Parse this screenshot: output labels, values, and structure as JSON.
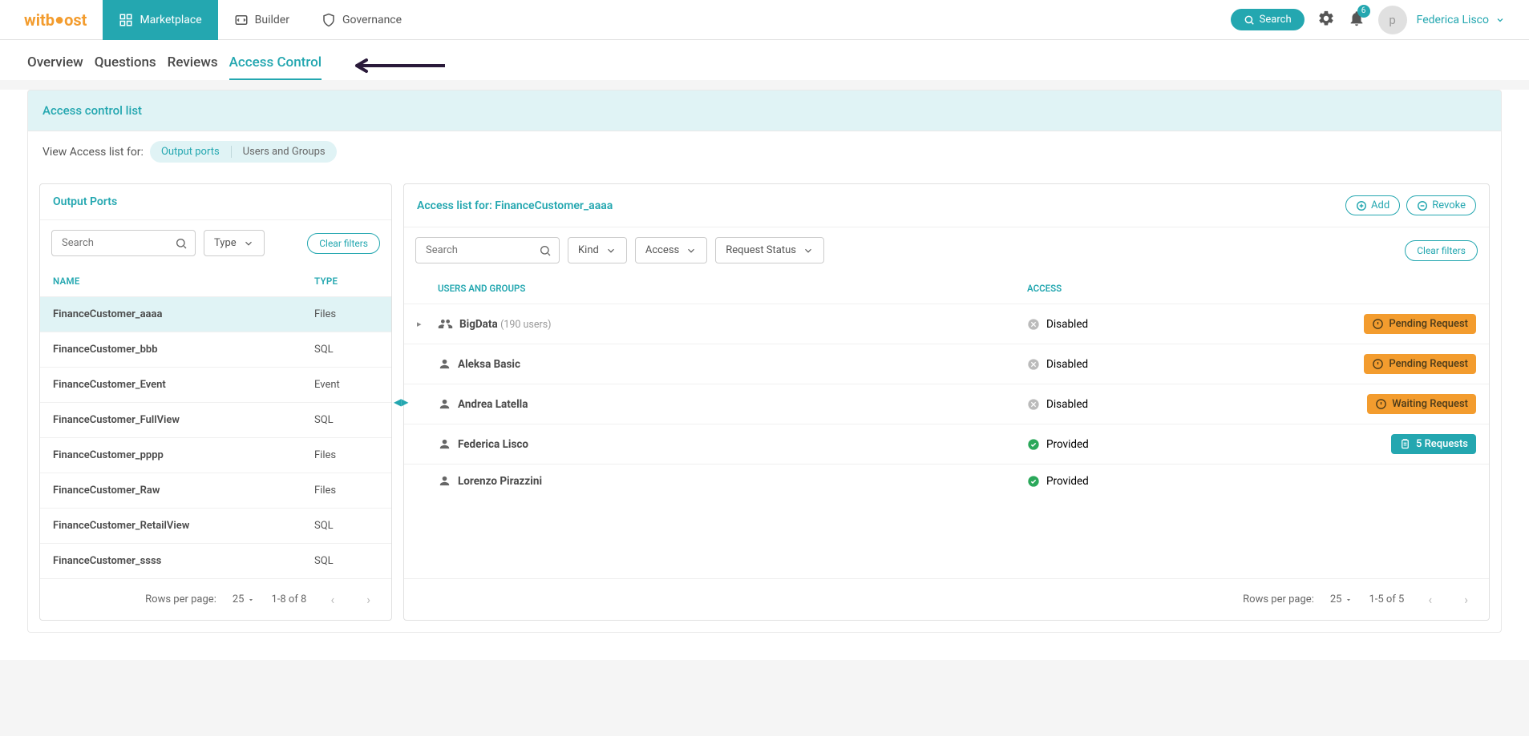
{
  "brand": {
    "part1": "witb",
    "part2": "o",
    "part3": "ost"
  },
  "nav": {
    "marketplace": "Marketplace",
    "builder": "Builder",
    "governance": "Governance"
  },
  "header": {
    "search": "Search",
    "notif_count": "6",
    "avatar_initial": "p",
    "user": "Federica Lisco"
  },
  "tabs": {
    "overview": "Overview",
    "questions": "Questions",
    "reviews": "Reviews",
    "access_control": "Access Control"
  },
  "acl": {
    "title": "Access control list",
    "view_for": "View Access list for:",
    "pill_output": "Output ports",
    "pill_users": "Users and Groups"
  },
  "left_panel": {
    "title": "Output Ports",
    "search_placeholder": "Search",
    "type_label": "Type",
    "clear": "Clear filters",
    "cols": {
      "name": "NAME",
      "type": "TYPE"
    },
    "rows": [
      {
        "name": "FinanceCustomer_aaaa",
        "type": "Files",
        "selected": true
      },
      {
        "name": "FinanceCustomer_bbb",
        "type": "SQL"
      },
      {
        "name": "FinanceCustomer_Event",
        "type": "Event"
      },
      {
        "name": "FinanceCustomer_FullView",
        "type": "SQL"
      },
      {
        "name": "FinanceCustomer_pppp",
        "type": "Files"
      },
      {
        "name": "FinanceCustomer_Raw",
        "type": "Files"
      },
      {
        "name": "FinanceCustomer_RetailView",
        "type": "SQL"
      },
      {
        "name": "FinanceCustomer_ssss",
        "type": "SQL"
      }
    ],
    "rpp_label": "Rows per page:",
    "rpp_value": "25",
    "range": "1-8 of 8"
  },
  "right_panel": {
    "title": "Access list for: FinanceCustomer_aaaa",
    "add": "Add",
    "revoke": "Revoke",
    "search_placeholder": "Search",
    "kind": "Kind",
    "access": "Access",
    "request_status": "Request Status",
    "clear": "Clear filters",
    "cols": {
      "users": "USERS AND GROUPS",
      "access": "ACCESS"
    },
    "rows": [
      {
        "expand": true,
        "group": true,
        "name": "BigData",
        "count": "(190 users)",
        "access": "Disabled",
        "chip": "Pending Request",
        "chip_style": "orange",
        "chip_icon": "info"
      },
      {
        "group": false,
        "name": "Aleksa Basic",
        "access": "Disabled",
        "chip": "Pending Request",
        "chip_style": "orange",
        "chip_icon": "info"
      },
      {
        "group": false,
        "name": "Andrea Latella",
        "access": "Disabled",
        "chip": "Waiting Request",
        "chip_style": "orange",
        "chip_icon": "info"
      },
      {
        "group": false,
        "name": "Federica Lisco",
        "access": "Provided",
        "chip": "5 Requests",
        "chip_style": "teal",
        "chip_icon": "clipboard"
      },
      {
        "group": false,
        "name": "Lorenzo Pirazzini",
        "access": "Provided"
      }
    ],
    "rpp_label": "Rows per page:",
    "rpp_value": "25",
    "range": "1-5 of 5"
  }
}
